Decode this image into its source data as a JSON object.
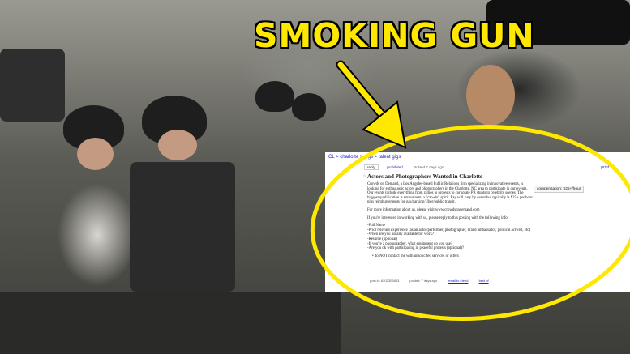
{
  "headline": "SMOKING GUN",
  "colors": {
    "headline": "#ffe800",
    "ellipse": "#ffe800",
    "link": "#2222cc"
  },
  "ad": {
    "breadcrumb": "CL > charlotte > gigs > talent gigs",
    "reply_button": "reply",
    "prohibited_link": "prohibited",
    "posted_label": "Posted 7 days ago",
    "print_link": "print",
    "title": "Actors and Photographers Wanted in Charlotte",
    "paragraphs": [
      "Crowds on Demand, a Los Angeles-based Public Relations firm specializing in innovative events, is looking for enthusiastic actors and photographers in the Charlotte, NC area to participate in our events. Our events include everything from rallies to protests to corporate PR stunts to celebrity scenes. The biggest qualification is enthusiasm, a \"can-do\" spirit. Pay will vary by event but typically is $25+ per hour plus reimbursements for gas/parking/Uber/public transit.",
      "For more information about us, please visit www.crowdsondemand.com",
      "If you're interested in working with us, please reply to this posting with the following info:",
      "-Full Name\n-Prior relevant experience (as an actor/performer, photographer, brand ambassador, political activist, etc)\n-When are you usually available for work?\n-Resume (optional)\n-If you're a photographer, what equipment do you use?\n-Are you ok with participating in peaceful protests (optional)?"
    ],
    "bullet": "do NOT contact me with unsolicited services or offers",
    "compensation": "compensation: $25+/hour",
    "footer": {
      "post_id": "post id: 6202306843",
      "posted": "posted: 7 days ago",
      "email_link": "email to friend",
      "best_of": "best of"
    }
  }
}
